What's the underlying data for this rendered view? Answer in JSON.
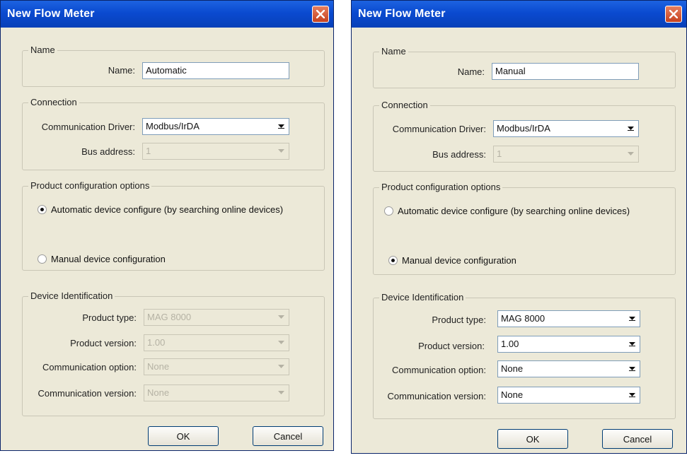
{
  "dialogs": [
    {
      "title": "New Flow Meter",
      "name_group": {
        "legend": "Name",
        "label": "Name:",
        "value": "Automatic"
      },
      "connection": {
        "legend": "Connection",
        "driver_label": "Communication Driver:",
        "driver_value": "Modbus/IrDA",
        "bus_label": "Bus address:",
        "bus_value": "1"
      },
      "product_options": {
        "legend": "Product configuration options",
        "auto_label": "Automatic device configure (by searching online devices)",
        "manual_label": "Manual device configuration",
        "selected": "automatic"
      },
      "device_identification": {
        "legend": "Device Identification",
        "product_type_label": "Product type:",
        "product_type_value": "MAG 8000",
        "product_version_label": "Product version:",
        "product_version_value": "1.00",
        "comm_option_label": "Communication option:",
        "comm_option_value": "None",
        "comm_version_label": "Communication version:",
        "comm_version_value": "None",
        "enabled": false
      },
      "ok_label": "OK",
      "cancel_label": "Cancel"
    },
    {
      "title": "New Flow Meter",
      "name_group": {
        "legend": "Name",
        "label": "Name:",
        "value": "Manual"
      },
      "connection": {
        "legend": "Connection",
        "driver_label": "Communication Driver:",
        "driver_value": "Modbus/IrDA",
        "bus_label": "Bus address:",
        "bus_value": "1"
      },
      "product_options": {
        "legend": "Product configuration options",
        "auto_label": "Automatic device configure (by searching online devices)",
        "manual_label": "Manual device configuration",
        "selected": "manual"
      },
      "device_identification": {
        "legend": "Device Identification",
        "product_type_label": "Product type:",
        "product_type_value": "MAG 8000",
        "product_version_label": "Product version:",
        "product_version_value": "1.00",
        "comm_option_label": "Communication option:",
        "comm_option_value": "None",
        "comm_version_label": "Communication version:",
        "comm_version_value": "None",
        "enabled": true
      },
      "ok_label": "OK",
      "cancel_label": "Cancel"
    }
  ],
  "colors": {
    "titlebar": "#0a4ad0",
    "dialog_bg": "#ece9d8",
    "close_button": "#c6411f"
  },
  "icons": {
    "close": "close-icon",
    "dropdown": "chevron-down-icon"
  }
}
